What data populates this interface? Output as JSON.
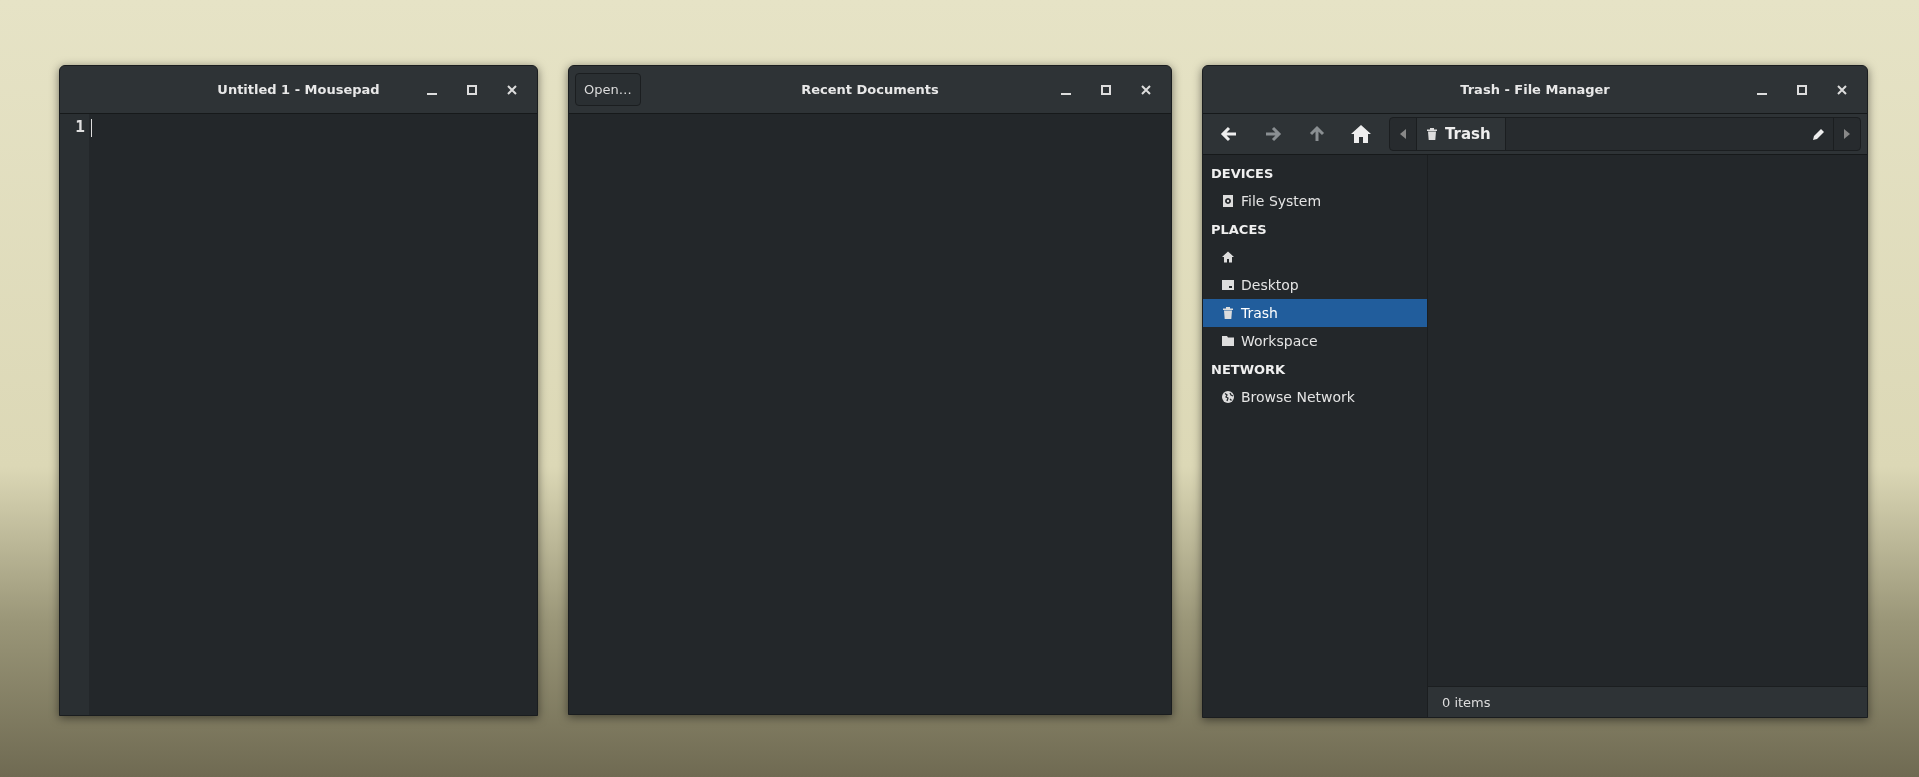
{
  "editor_window": {
    "title": "Untitled 1 - Mousepad",
    "line_numbers": [
      "1"
    ]
  },
  "recent_window": {
    "title": "Recent Documents",
    "open_button": "Open…"
  },
  "file_manager": {
    "title": "Trash - File Manager",
    "toolbar": {
      "back_disabled": false,
      "forward_disabled": true,
      "up_disabled": true
    },
    "path_bar": {
      "crumbs": [
        {
          "kind": "trash",
          "label": "Trash",
          "selected": true
        }
      ]
    },
    "sidebar": [
      {
        "heading": "DEVICES",
        "items": [
          {
            "kind": "drive",
            "label": "File System",
            "selected": false
          }
        ]
      },
      {
        "heading": "PLACES",
        "items": [
          {
            "kind": "home",
            "selected": false
          },
          {
            "kind": "desktop",
            "label": "Desktop",
            "selected": false
          },
          {
            "kind": "trash",
            "label": "Trash",
            "selected": true
          },
          {
            "kind": "folder",
            "label": "Workspace",
            "selected": false
          }
        ]
      },
      {
        "heading": "NETWORK",
        "items": [
          {
            "kind": "network",
            "label": "Browse Network",
            "selected": false
          }
        ]
      }
    ],
    "status_bar": "0 items"
  }
}
